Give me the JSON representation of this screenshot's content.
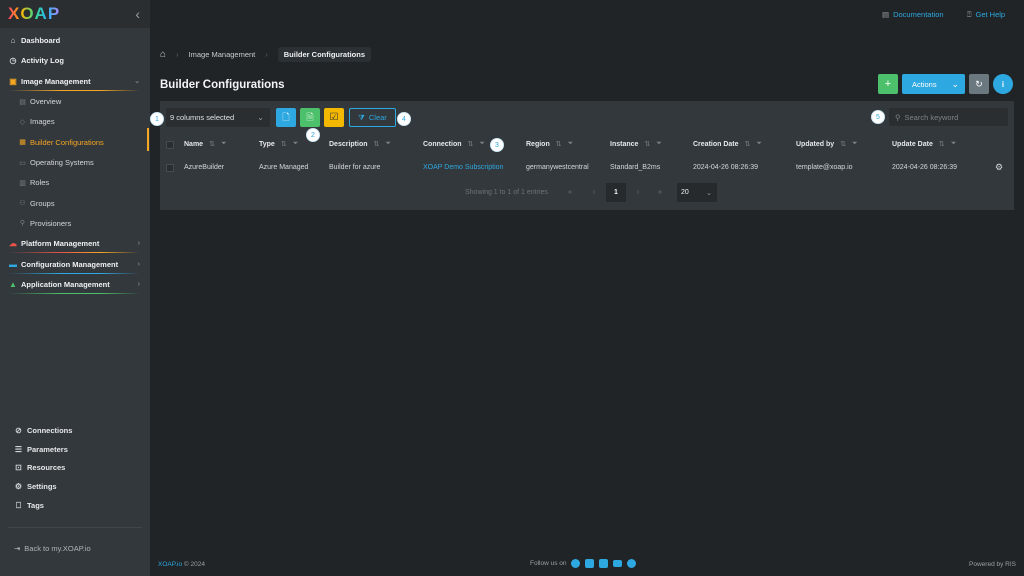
{
  "sidebar": {
    "logo": "XOAP",
    "items": [
      {
        "label": "Dashboard",
        "icon": "home-icon"
      },
      {
        "label": "Activity Log",
        "icon": "clock-icon"
      },
      {
        "label": "Image Management",
        "icon": "images-icon",
        "expanded": true,
        "children": [
          {
            "label": "Overview",
            "icon": "overview-icon"
          },
          {
            "label": "Images",
            "icon": "image-icon"
          },
          {
            "label": "Builder Configurations",
            "icon": "builder-icon",
            "active": true
          },
          {
            "label": "Operating Systems",
            "icon": "monitor-icon"
          },
          {
            "label": "Roles",
            "icon": "roles-icon"
          },
          {
            "label": "Groups",
            "icon": "groups-icon"
          },
          {
            "label": "Provisioners",
            "icon": "provisioner-icon"
          }
        ]
      },
      {
        "label": "Platform Management",
        "icon": "cloud-icon"
      },
      {
        "label": "Configuration Management",
        "icon": "config-icon"
      },
      {
        "label": "Application Management",
        "icon": "chart-icon"
      }
    ],
    "bottom": [
      {
        "label": "Connections",
        "icon": "link-icon"
      },
      {
        "label": "Parameters",
        "icon": "list-icon"
      },
      {
        "label": "Resources",
        "icon": "inbox-icon"
      },
      {
        "label": "Settings",
        "icon": "gear-icon"
      },
      {
        "label": "Tags",
        "icon": "bookmark-icon"
      }
    ],
    "back_label": "Back to my.XOAP.io"
  },
  "topbar": {
    "documentation": "Documentation",
    "help": "Get Help"
  },
  "breadcrumb": {
    "items": [
      "Image Management",
      "Builder Configurations"
    ]
  },
  "page": {
    "title": "Builder Configurations"
  },
  "toolbar": {
    "columns_selected": "9 columns selected",
    "clear_label": "Clear",
    "add_label": "+",
    "actions_label": "Actions",
    "search_placeholder": "Search keyword",
    "badges": [
      "1",
      "2",
      "3",
      "4",
      "5"
    ]
  },
  "table": {
    "columns": [
      "Name",
      "Type",
      "Description",
      "Connection",
      "Region",
      "Instance",
      "Creation Date",
      "Updated by",
      "Update Date"
    ],
    "rows": [
      {
        "name": "AzureBuilder",
        "type": "Azure Managed",
        "description": "Builder for azure",
        "connection": "XOAP Demo Subscription",
        "region": "germanywestcentral",
        "instance": "Standard_B2ms",
        "creation_date": "2024-04-26 08:26:39",
        "updated_by": "template@xoap.io",
        "update_date": "2024-04-26 08:26:39"
      }
    ]
  },
  "pagination": {
    "summary": "Showing 1 to 1 of 1 entries",
    "current_page": "1",
    "page_size": "20",
    "first": "«",
    "prev": "‹",
    "next": "›",
    "last": "»"
  },
  "footer": {
    "brand": "XOAP.io",
    "copyright": "© 2024",
    "follow": "Follow us on",
    "powered": "Powered by RIS"
  },
  "colors": {
    "accent": "#2ea8e0",
    "active": "#f5a623",
    "green": "#4cc06a",
    "yellow": "#f5b800"
  }
}
